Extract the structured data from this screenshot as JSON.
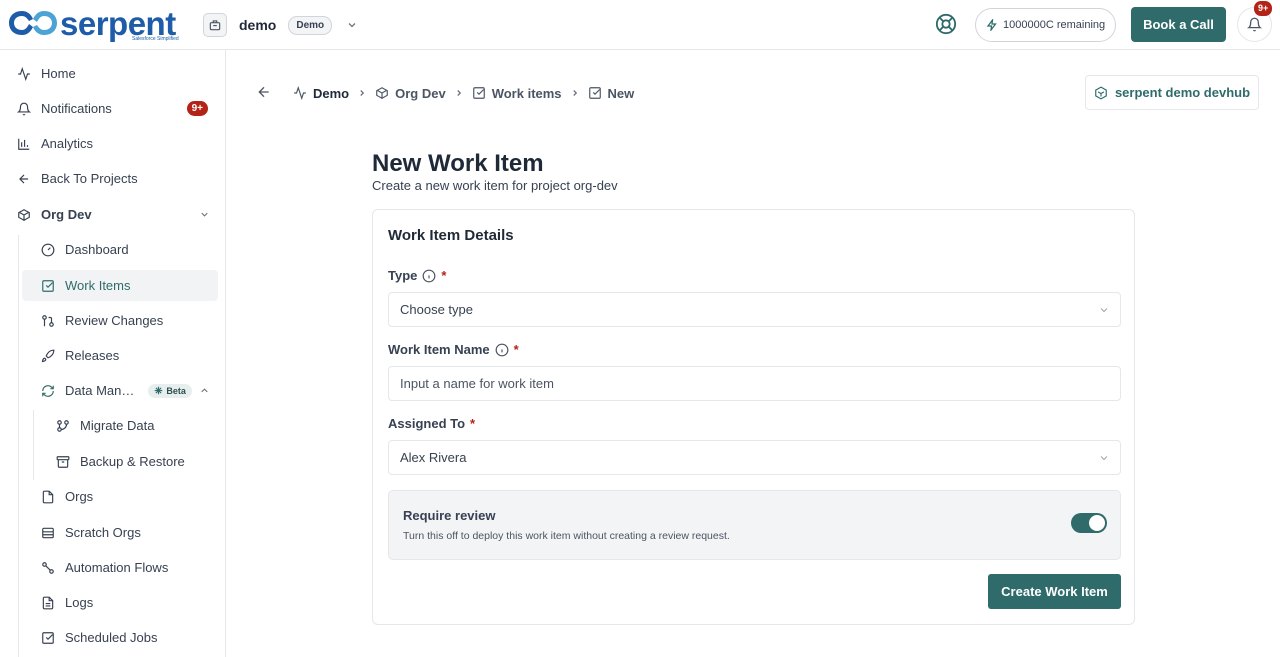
{
  "brand": {
    "name": "serpent",
    "tagline": "Salesforce Simplified",
    "primary_color": "#2f6b6b",
    "logo_color": "#1e5ba8"
  },
  "topbar": {
    "org_name": "demo",
    "org_badge": "Demo",
    "remaining": "1000000C remaining",
    "book_call": "Book a Call",
    "bell_badge": "9+"
  },
  "sidebar": {
    "items": [
      {
        "label": "Home",
        "icon": "activity-icon"
      },
      {
        "label": "Notifications",
        "icon": "bell-icon",
        "count": "9+"
      },
      {
        "label": "Analytics",
        "icon": "bar-chart-icon"
      },
      {
        "label": "Back To Projects",
        "icon": "arrow-left-icon"
      },
      {
        "label": "Org Dev",
        "icon": "box-icon"
      },
      {
        "label": "Dashboard",
        "icon": "gauge-icon"
      },
      {
        "label": "Work Items",
        "icon": "check-square-icon"
      },
      {
        "label": "Review Changes",
        "icon": "git-pull-request-icon"
      },
      {
        "label": "Releases",
        "icon": "rocket-icon"
      },
      {
        "label": "Data Man…",
        "icon": "refresh-icon",
        "badge": "Beta"
      },
      {
        "label": "Migrate Data",
        "icon": "git-branch-icon"
      },
      {
        "label": "Backup & Restore",
        "icon": "archive-icon"
      },
      {
        "label": "Orgs",
        "icon": "file-icon"
      },
      {
        "label": "Scratch Orgs",
        "icon": "database-icon"
      },
      {
        "label": "Automation Flows",
        "icon": "workflow-icon"
      },
      {
        "label": "Logs",
        "icon": "log-file-icon"
      },
      {
        "label": "Scheduled Jobs",
        "icon": "calendar-check-icon"
      }
    ]
  },
  "breadcrumb": [
    "Demo",
    "Org Dev",
    "Work items",
    "New"
  ],
  "devhub_label": "serpent demo devhub",
  "page": {
    "title": "New Work Item",
    "subtitle": "Create a new work item for project org-dev"
  },
  "form": {
    "section_title": "Work Item Details",
    "type_label": "Type",
    "type_value": "Choose type",
    "name_label": "Work Item Name",
    "name_placeholder": "Input a name for work item",
    "assigned_label": "Assigned To",
    "assigned_value": "Alex Rivera",
    "required_mark": "*",
    "review_title": "Require review",
    "review_desc": "Turn this off to deploy this work item without creating a review request.",
    "review_enabled": true,
    "submit_label": "Create Work Item"
  }
}
